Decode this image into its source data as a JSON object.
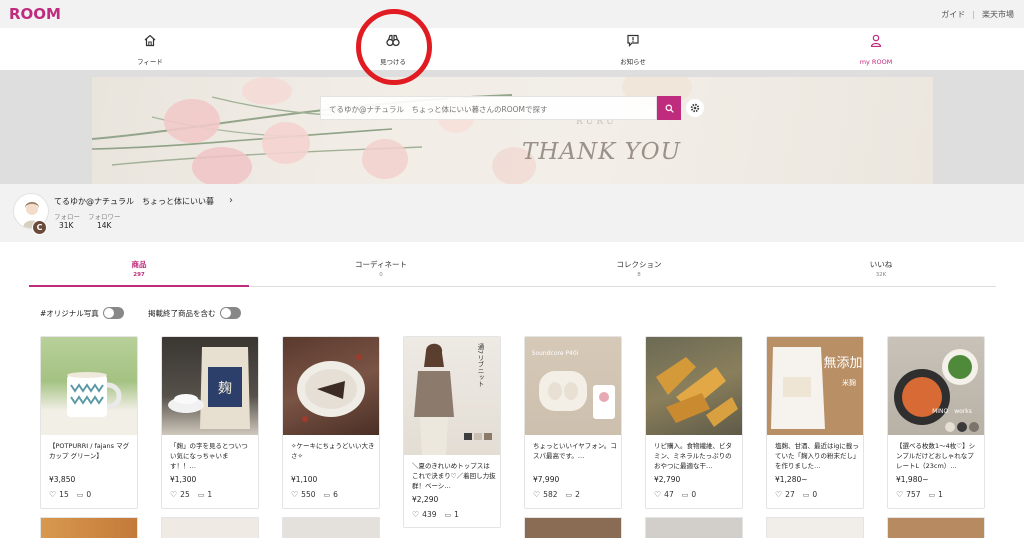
{
  "header": {
    "logo": "ROOM",
    "links": [
      "ガイド",
      "楽天市場"
    ]
  },
  "nav": [
    {
      "label": "フィード",
      "icon": "home-icon"
    },
    {
      "label": "見つける",
      "icon": "binoculars-icon"
    },
    {
      "label": "お知らせ",
      "icon": "notification-icon"
    },
    {
      "label": "my ROOM",
      "icon": "person-icon"
    }
  ],
  "banner": {
    "search_placeholder": "てるゆか@ナチュラル　ちょっと体にいい暮さんのROOMで探す",
    "overlay_text": "THANK YOU",
    "watermark_text": "RURU"
  },
  "profile": {
    "name": "てるゆか@ナチュラル　ちょっと体にいい暮",
    "badge": "C",
    "follow_label": "フォロー",
    "follower_label": "フォロワー",
    "follow_count": "31K",
    "follower_count": "14K"
  },
  "tabs": [
    {
      "label": "商品",
      "count": "297",
      "active": true
    },
    {
      "label": "コーディネート",
      "count": "0",
      "active": false
    },
    {
      "label": "コレクション",
      "count": "8",
      "active": false
    },
    {
      "label": "いいね",
      "count": "32K",
      "active": false
    }
  ],
  "filters": [
    {
      "label": "#オリジナル写真"
    },
    {
      "label": "掲載終了商品を含む"
    }
  ],
  "products": [
    {
      "name": "【POTPURRI / fajans マグカップ グリーン】",
      "price": "¥3,850",
      "likes": "15",
      "comments": "0"
    },
    {
      "name": "「麹」の字を見るとついつい気になっちゃいます！！…",
      "price": "¥1,300",
      "likes": "25",
      "comments": "1"
    },
    {
      "name": "✧ケーキにちょうどいい大きさ✧",
      "price": "¥1,100",
      "likes": "550",
      "comments": "6"
    },
    {
      "name": "＼夏のきれいめトップスはこれで決まり♡／着回し力抜群！ベーシ…",
      "price": "¥2,290",
      "likes": "439",
      "comments": "1"
    },
    {
      "name": "ちょっといいイヤフォン。コスパ最高です。…",
      "price": "¥7,990",
      "likes": "582",
      "comments": "2"
    },
    {
      "name": "リピ購入。食物繊維、ビタミン、ミネラルたっぷりのおやつに最適な干…",
      "price": "¥2,790",
      "likes": "47",
      "comments": "0"
    },
    {
      "name": "塩麹、甘酒、最近はigに載っていた「麹入りの粉末だし」を作りました…",
      "price": "¥1,280~",
      "likes": "27",
      "comments": "0"
    },
    {
      "name": "【選べる枚数1〜4枚♡】シンプルだけどおしゃれなプレートL（23cm）…",
      "price": "¥1,980~",
      "likes": "757",
      "comments": "1"
    }
  ],
  "product_image_texts": {
    "koji_pack": "麹",
    "summer_knit": "通7リブニット",
    "earphone_brand": "Soundcore P40i",
    "mutenka": "無添加",
    "mutenka_sub": "米麹",
    "plate_brand": "MINO　works"
  },
  "colors": {
    "brand": "#bf2c7d",
    "highlight_circle": "#e11b22"
  }
}
